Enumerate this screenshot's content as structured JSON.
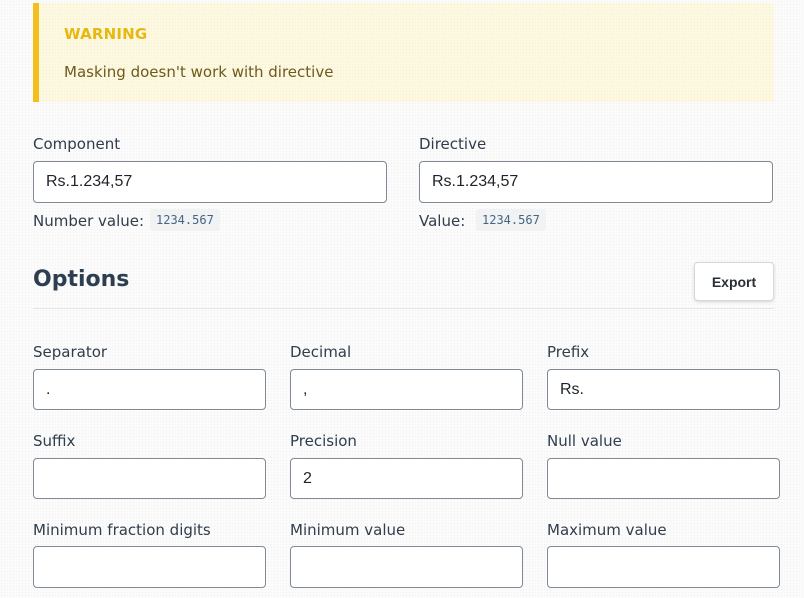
{
  "warning": {
    "title": "WARNING",
    "message": "Masking doesn't work with directive"
  },
  "component": {
    "label": "Component",
    "value": "Rs.1.234,57",
    "number_label": "Number value:",
    "number_value": "1234.567"
  },
  "directive": {
    "label": "Directive",
    "value": "Rs.1.234,57",
    "value_label": "Value:",
    "value_value": "1234.567"
  },
  "options": {
    "title": "Options",
    "export_label": "Export",
    "fields": {
      "separator": {
        "label": "Separator",
        "value": "."
      },
      "decimal": {
        "label": "Decimal",
        "value": ","
      },
      "prefix": {
        "label": "Prefix",
        "value": "Rs."
      },
      "suffix": {
        "label": "Suffix",
        "value": ""
      },
      "precision": {
        "label": "Precision",
        "value": "2"
      },
      "null_value": {
        "label": "Null value",
        "value": ""
      },
      "min_fraction_digits": {
        "label": "Minimum fraction digits",
        "value": ""
      },
      "min_value": {
        "label": "Minimum value",
        "value": ""
      },
      "max_value": {
        "label": "Maximum value",
        "value": ""
      }
    }
  },
  "colors": {
    "warning_accent": "#f5be1f",
    "warning_background": "#fdf8e1",
    "text": "#2c3e50"
  }
}
